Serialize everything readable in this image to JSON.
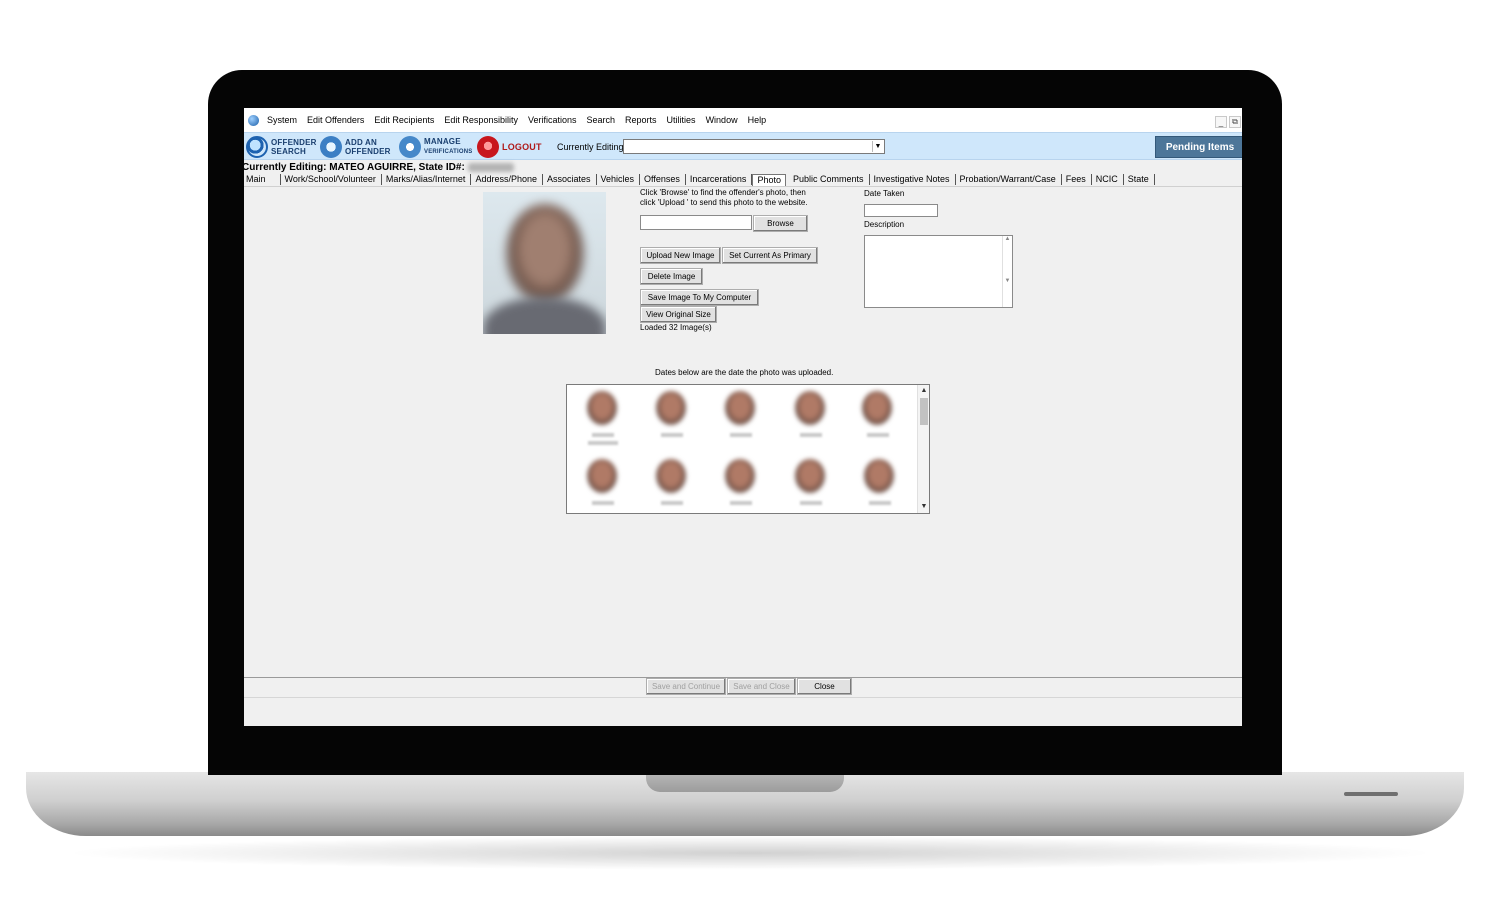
{
  "menu": {
    "items": [
      "System",
      "Edit Offenders",
      "Edit Recipients",
      "Edit Responsibility",
      "Verifications",
      "Search",
      "Reports",
      "Utilities",
      "Window",
      "Help"
    ],
    "min_label": "_",
    "restore_label": "⧉"
  },
  "toolbar": {
    "offender_search": [
      "OFFENDER",
      "SEARCH"
    ],
    "add_offender": [
      "ADD AN",
      "OFFENDER"
    ],
    "manage_verifications": [
      "MANAGE",
      "VERIFICATIONS"
    ],
    "logout": "LOGOUT",
    "currently_editing_label": "Currently Editing:",
    "currently_editing_value": "",
    "pending_items": "Pending Items"
  },
  "editing_header": {
    "text": "Currently Editing: MATEO AGUIRRE, State ID#:"
  },
  "tabs": [
    "Main",
    "Work/School/Volunteer",
    "Marks/Alias/Internet",
    "Address/Phone",
    "Associates",
    "Vehicles",
    "Offenses",
    "Incarcerations",
    "Photo",
    "Public Comments",
    "Investigative Notes",
    "Probation/Warrant/Case",
    "Fees",
    "NCIC",
    "State"
  ],
  "active_tab": "Photo",
  "photo": {
    "help_line1": "Click 'Browse' to find the offender's photo, then",
    "help_line2": "click 'Upload ' to send this photo to the website.",
    "file_value": "",
    "browse": "Browse",
    "upload_new_image": "Upload New Image",
    "set_current_primary": "Set Current As Primary",
    "delete_image": "Delete Image",
    "save_image": "Save Image To My Computer",
    "view_original": "View Original Size",
    "loaded": "Loaded 32 Image(s)",
    "date_taken_label": "Date Taken",
    "date_taken_value": "",
    "description_label": "Description",
    "description_value": "",
    "upload_note": "Dates below are the date the photo was uploaded."
  },
  "footer": {
    "save_continue": "Save and Continue",
    "save_close": "Save and Close",
    "close": "Close"
  },
  "colors": {
    "toolbar_bg": "#cfe7fb",
    "pending_bg": "#4d7699",
    "window_bg": "#f0f0f0"
  }
}
